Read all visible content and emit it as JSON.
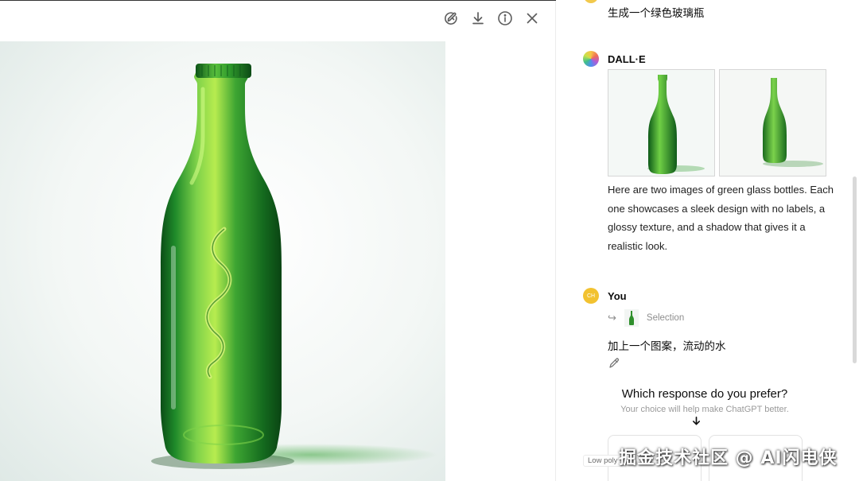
{
  "viewer": {
    "toolbar": [
      {
        "name": "edit-image-icon",
        "label": "Edit"
      },
      {
        "name": "download-icon",
        "label": "Download"
      },
      {
        "name": "info-icon",
        "label": "Info"
      },
      {
        "name": "close-icon",
        "label": "Close"
      }
    ],
    "image_subject": "green-glass-bottle-with-water-pattern"
  },
  "chat": {
    "prev_user_message": "生成一个绿色玻璃瓶",
    "assistant": {
      "name": "DALL·E",
      "reply": "Here are two images of green glass bottles. Each one showcases a sleek design with no labels, a glossy texture, and a shadow that gives it a realistic look."
    },
    "user": {
      "name": "You",
      "avatar_text": "CH",
      "selection_label": "Selection",
      "message": "加上一个图案，流动的水"
    },
    "preference": {
      "title": "Which response do you prefer?",
      "subtitle": "Your choice will help make ChatGPT better."
    },
    "tooltip": "Low poly"
  },
  "watermark": "掘金技术社区 @ AI闪电侠",
  "colors": {
    "bottle_green": "#1f8a2a",
    "avatar_you": "#f2c230",
    "text_primary": "#0d0d0d",
    "text_muted": "#9a9a9a"
  }
}
